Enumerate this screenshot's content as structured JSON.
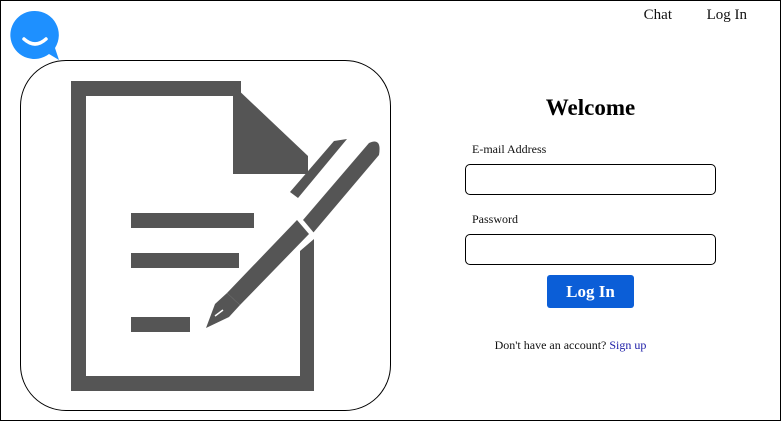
{
  "colors": {
    "accent": "#0b5ed7",
    "logo": "#1e90ff",
    "illustration": "#555555",
    "link": "#1a1aa6"
  },
  "logo": {
    "icon": "chat-bubble-smile-icon"
  },
  "nav": {
    "chat_label": "Chat",
    "login_label": "Log In"
  },
  "hero": {
    "icon": "document-with-pen-icon"
  },
  "form": {
    "title": "Welcome",
    "email_label": "E-mail Address",
    "email_value": "",
    "password_label": "Password",
    "password_value": "",
    "submit_label": "Log In",
    "signup_prompt": "Don't have an account?",
    "signup_link": "Sign up"
  }
}
